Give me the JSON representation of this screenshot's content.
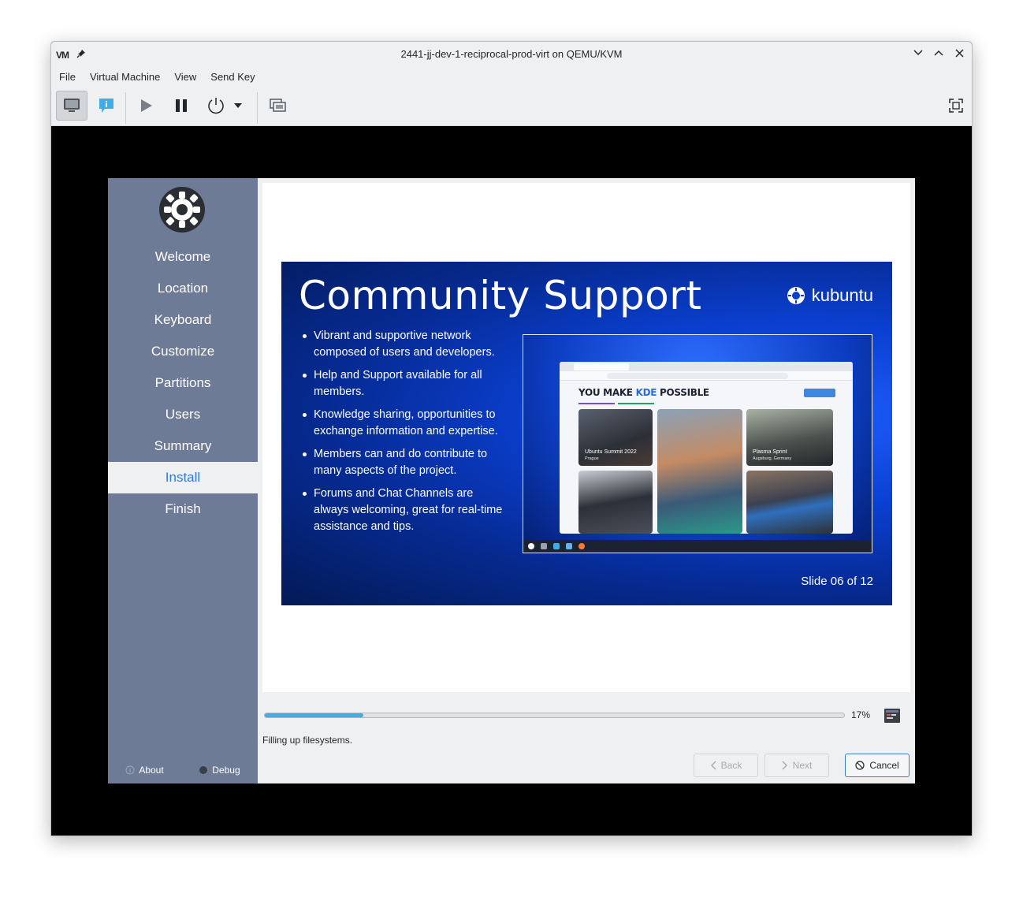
{
  "window": {
    "title": "2441-jj-dev-1-reciprocal-prod-virt on QEMU/KVM",
    "logo_text": "VM"
  },
  "menu": [
    "File",
    "Virtual Machine",
    "View",
    "Send Key"
  ],
  "toolbar_icons": [
    "console-icon",
    "details-icon",
    "run-icon",
    "pause-icon",
    "shutdown-icon",
    "dropdown-icon",
    "snapshots-icon",
    "fullscreen-icon"
  ],
  "installer": {
    "steps": [
      "Welcome",
      "Location",
      "Keyboard",
      "Customize",
      "Partitions",
      "Users",
      "Summary",
      "Install",
      "Finish"
    ],
    "current_step": "Install",
    "footer": {
      "about": "About",
      "debug": "Debug"
    },
    "slide": {
      "title": "Community Support",
      "brand": "kubuntu",
      "bullets": [
        "Vibrant and supportive network composed of users and developers.",
        "Help and Support available for all members.",
        "Knowledge sharing, opportunities to exchange information and expertise.",
        "Members can and do contribute to many aspects of the project.",
        "Forums  and Chat Channels are always welcoming, great for real-time assistance and tips."
      ],
      "screenshot": {
        "headline_prefix": "YOU MAKE ",
        "headline_kde": "KDE",
        "headline_suffix": " POSSIBLE",
        "photo1_caption": "Ubuntu Summit 2022",
        "photo1_sub": "Prague",
        "photo2_caption": "Plasma Sprint",
        "photo2_sub": "Augsburg, Germany"
      },
      "number": "Slide 06 of 12"
    },
    "progress": {
      "percent": 17,
      "label": "17%"
    },
    "status": "Filling up filesystems.",
    "buttons": {
      "back": "Back",
      "next": "Next",
      "cancel": "Cancel"
    }
  },
  "colors": {
    "sidebar": "#6e7b97",
    "accent": "#2f7bd4",
    "progress": "#3daee9"
  }
}
